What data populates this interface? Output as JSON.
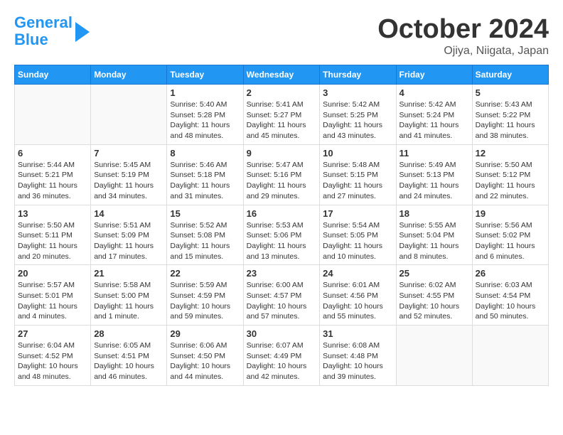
{
  "header": {
    "logo_line1": "General",
    "logo_line2": "Blue",
    "title": "October 2024",
    "subtitle": "Ojiya, Niigata, Japan"
  },
  "days_of_week": [
    "Sunday",
    "Monday",
    "Tuesday",
    "Wednesday",
    "Thursday",
    "Friday",
    "Saturday"
  ],
  "weeks": [
    [
      {
        "day": "",
        "info": ""
      },
      {
        "day": "",
        "info": ""
      },
      {
        "day": "1",
        "info": "Sunrise: 5:40 AM\nSunset: 5:28 PM\nDaylight: 11 hours and 48 minutes."
      },
      {
        "day": "2",
        "info": "Sunrise: 5:41 AM\nSunset: 5:27 PM\nDaylight: 11 hours and 45 minutes."
      },
      {
        "day": "3",
        "info": "Sunrise: 5:42 AM\nSunset: 5:25 PM\nDaylight: 11 hours and 43 minutes."
      },
      {
        "day": "4",
        "info": "Sunrise: 5:42 AM\nSunset: 5:24 PM\nDaylight: 11 hours and 41 minutes."
      },
      {
        "day": "5",
        "info": "Sunrise: 5:43 AM\nSunset: 5:22 PM\nDaylight: 11 hours and 38 minutes."
      }
    ],
    [
      {
        "day": "6",
        "info": "Sunrise: 5:44 AM\nSunset: 5:21 PM\nDaylight: 11 hours and 36 minutes."
      },
      {
        "day": "7",
        "info": "Sunrise: 5:45 AM\nSunset: 5:19 PM\nDaylight: 11 hours and 34 minutes."
      },
      {
        "day": "8",
        "info": "Sunrise: 5:46 AM\nSunset: 5:18 PM\nDaylight: 11 hours and 31 minutes."
      },
      {
        "day": "9",
        "info": "Sunrise: 5:47 AM\nSunset: 5:16 PM\nDaylight: 11 hours and 29 minutes."
      },
      {
        "day": "10",
        "info": "Sunrise: 5:48 AM\nSunset: 5:15 PM\nDaylight: 11 hours and 27 minutes."
      },
      {
        "day": "11",
        "info": "Sunrise: 5:49 AM\nSunset: 5:13 PM\nDaylight: 11 hours and 24 minutes."
      },
      {
        "day": "12",
        "info": "Sunrise: 5:50 AM\nSunset: 5:12 PM\nDaylight: 11 hours and 22 minutes."
      }
    ],
    [
      {
        "day": "13",
        "info": "Sunrise: 5:50 AM\nSunset: 5:11 PM\nDaylight: 11 hours and 20 minutes."
      },
      {
        "day": "14",
        "info": "Sunrise: 5:51 AM\nSunset: 5:09 PM\nDaylight: 11 hours and 17 minutes."
      },
      {
        "day": "15",
        "info": "Sunrise: 5:52 AM\nSunset: 5:08 PM\nDaylight: 11 hours and 15 minutes."
      },
      {
        "day": "16",
        "info": "Sunrise: 5:53 AM\nSunset: 5:06 PM\nDaylight: 11 hours and 13 minutes."
      },
      {
        "day": "17",
        "info": "Sunrise: 5:54 AM\nSunset: 5:05 PM\nDaylight: 11 hours and 10 minutes."
      },
      {
        "day": "18",
        "info": "Sunrise: 5:55 AM\nSunset: 5:04 PM\nDaylight: 11 hours and 8 minutes."
      },
      {
        "day": "19",
        "info": "Sunrise: 5:56 AM\nSunset: 5:02 PM\nDaylight: 11 hours and 6 minutes."
      }
    ],
    [
      {
        "day": "20",
        "info": "Sunrise: 5:57 AM\nSunset: 5:01 PM\nDaylight: 11 hours and 4 minutes."
      },
      {
        "day": "21",
        "info": "Sunrise: 5:58 AM\nSunset: 5:00 PM\nDaylight: 11 hours and 1 minute."
      },
      {
        "day": "22",
        "info": "Sunrise: 5:59 AM\nSunset: 4:59 PM\nDaylight: 10 hours and 59 minutes."
      },
      {
        "day": "23",
        "info": "Sunrise: 6:00 AM\nSunset: 4:57 PM\nDaylight: 10 hours and 57 minutes."
      },
      {
        "day": "24",
        "info": "Sunrise: 6:01 AM\nSunset: 4:56 PM\nDaylight: 10 hours and 55 minutes."
      },
      {
        "day": "25",
        "info": "Sunrise: 6:02 AM\nSunset: 4:55 PM\nDaylight: 10 hours and 52 minutes."
      },
      {
        "day": "26",
        "info": "Sunrise: 6:03 AM\nSunset: 4:54 PM\nDaylight: 10 hours and 50 minutes."
      }
    ],
    [
      {
        "day": "27",
        "info": "Sunrise: 6:04 AM\nSunset: 4:52 PM\nDaylight: 10 hours and 48 minutes."
      },
      {
        "day": "28",
        "info": "Sunrise: 6:05 AM\nSunset: 4:51 PM\nDaylight: 10 hours and 46 minutes."
      },
      {
        "day": "29",
        "info": "Sunrise: 6:06 AM\nSunset: 4:50 PM\nDaylight: 10 hours and 44 minutes."
      },
      {
        "day": "30",
        "info": "Sunrise: 6:07 AM\nSunset: 4:49 PM\nDaylight: 10 hours and 42 minutes."
      },
      {
        "day": "31",
        "info": "Sunrise: 6:08 AM\nSunset: 4:48 PM\nDaylight: 10 hours and 39 minutes."
      },
      {
        "day": "",
        "info": ""
      },
      {
        "day": "",
        "info": ""
      }
    ]
  ]
}
